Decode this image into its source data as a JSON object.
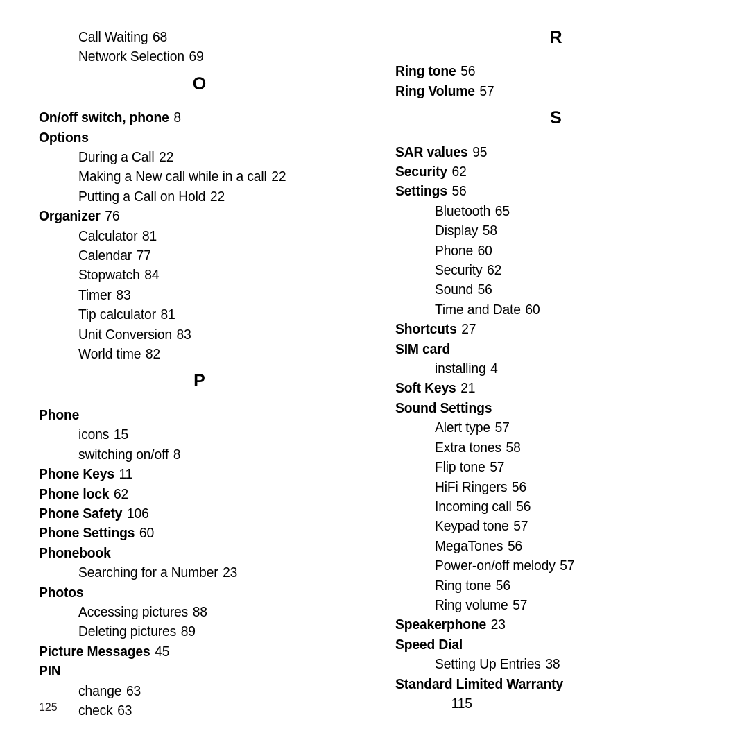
{
  "page": {
    "folio": "125",
    "document_type": "index"
  },
  "columns": {
    "left": [
      {
        "kind": "sub",
        "label": "Call Waiting",
        "page": "68"
      },
      {
        "kind": "sub",
        "label": "Network Selection",
        "page": "69"
      },
      {
        "kind": "letter",
        "label": "O"
      },
      {
        "kind": "main",
        "label": "On/off switch, phone",
        "page": "8"
      },
      {
        "kind": "main",
        "label": "Options",
        "page": ""
      },
      {
        "kind": "sub",
        "label": "During a Call",
        "page": "22"
      },
      {
        "kind": "sub",
        "label": "Making a New call while in a call",
        "page": "22"
      },
      {
        "kind": "sub",
        "label": "Putting a Call on Hold",
        "page": "22"
      },
      {
        "kind": "main",
        "label": "Organizer",
        "page": "76"
      },
      {
        "kind": "sub",
        "label": "Calculator",
        "page": "81"
      },
      {
        "kind": "sub",
        "label": "Calendar",
        "page": "77"
      },
      {
        "kind": "sub",
        "label": "Stopwatch",
        "page": "84"
      },
      {
        "kind": "sub",
        "label": "Timer",
        "page": "83"
      },
      {
        "kind": "sub",
        "label": "Tip calculator",
        "page": "81"
      },
      {
        "kind": "sub",
        "label": "Unit Conversion",
        "page": "83"
      },
      {
        "kind": "sub",
        "label": "World time",
        "page": "82"
      },
      {
        "kind": "letter",
        "label": "P"
      },
      {
        "kind": "main",
        "label": "Phone",
        "page": ""
      },
      {
        "kind": "sub",
        "label": "icons",
        "page": "15"
      },
      {
        "kind": "sub",
        "label": "switching on/off",
        "page": "8"
      },
      {
        "kind": "main",
        "label": "Phone Keys",
        "page": "11"
      },
      {
        "kind": "main",
        "label": "Phone lock",
        "page": "62"
      },
      {
        "kind": "main",
        "label": "Phone Safety",
        "page": "106"
      },
      {
        "kind": "main",
        "label": "Phone Settings",
        "page": "60"
      },
      {
        "kind": "main",
        "label": "Phonebook",
        "page": ""
      },
      {
        "kind": "sub",
        "label": "Searching for a Number",
        "page": "23"
      },
      {
        "kind": "main",
        "label": "Photos",
        "page": ""
      },
      {
        "kind": "sub",
        "label": "Accessing pictures",
        "page": "88"
      },
      {
        "kind": "sub",
        "label": "Deleting pictures",
        "page": "89"
      },
      {
        "kind": "main",
        "label": "Picture Messages",
        "page": "45"
      },
      {
        "kind": "main",
        "label": "PIN",
        "page": ""
      },
      {
        "kind": "sub",
        "label": "change",
        "page": "63"
      },
      {
        "kind": "sub",
        "label": "check",
        "page": "63"
      }
    ],
    "right": [
      {
        "kind": "letter",
        "label": "R"
      },
      {
        "kind": "main",
        "label": "Ring tone",
        "page": "56"
      },
      {
        "kind": "main",
        "label": "Ring Volume",
        "page": "57"
      },
      {
        "kind": "letter",
        "label": "S"
      },
      {
        "kind": "main",
        "label": "SAR values",
        "page": "95"
      },
      {
        "kind": "main",
        "label": "Security",
        "page": "62"
      },
      {
        "kind": "main",
        "label": "Settings",
        "page": "56"
      },
      {
        "kind": "sub",
        "label": "Bluetooth",
        "page": "65"
      },
      {
        "kind": "sub",
        "label": "Display",
        "page": "58"
      },
      {
        "kind": "sub",
        "label": "Phone",
        "page": "60"
      },
      {
        "kind": "sub",
        "label": "Security",
        "page": "62"
      },
      {
        "kind": "sub",
        "label": "Sound",
        "page": "56"
      },
      {
        "kind": "sub",
        "label": "Time and Date",
        "page": "60"
      },
      {
        "kind": "main",
        "label": "Shortcuts",
        "page": "27"
      },
      {
        "kind": "main",
        "label": "SIM card",
        "page": ""
      },
      {
        "kind": "sub",
        "label": "installing",
        "page": "4"
      },
      {
        "kind": "main",
        "label": "Soft Keys",
        "page": "21"
      },
      {
        "kind": "main",
        "label": "Sound Settings",
        "page": ""
      },
      {
        "kind": "sub",
        "label": "Alert type",
        "page": "57"
      },
      {
        "kind": "sub",
        "label": "Extra tones",
        "page": "58"
      },
      {
        "kind": "sub",
        "label": "Flip tone",
        "page": "57"
      },
      {
        "kind": "sub",
        "label": "HiFi Ringers",
        "page": "56"
      },
      {
        "kind": "sub",
        "label": "Incoming call",
        "page": "56"
      },
      {
        "kind": "sub",
        "label": "Keypad tone",
        "page": "57"
      },
      {
        "kind": "sub",
        "label": "MegaTones",
        "page": "56"
      },
      {
        "kind": "sub",
        "label": "Power-on/off melody",
        "page": "57"
      },
      {
        "kind": "sub",
        "label": "Ring tone",
        "page": "56"
      },
      {
        "kind": "sub",
        "label": "Ring volume",
        "page": "57"
      },
      {
        "kind": "main",
        "label": "Speakerphone",
        "page": "23"
      },
      {
        "kind": "main",
        "label": "Speed Dial",
        "page": ""
      },
      {
        "kind": "sub",
        "label": "Setting Up Entries",
        "page": "38"
      },
      {
        "kind": "main",
        "label": "Standard Limited Warranty",
        "page": ""
      },
      {
        "kind": "cont",
        "label": "",
        "page": "115"
      }
    ]
  }
}
